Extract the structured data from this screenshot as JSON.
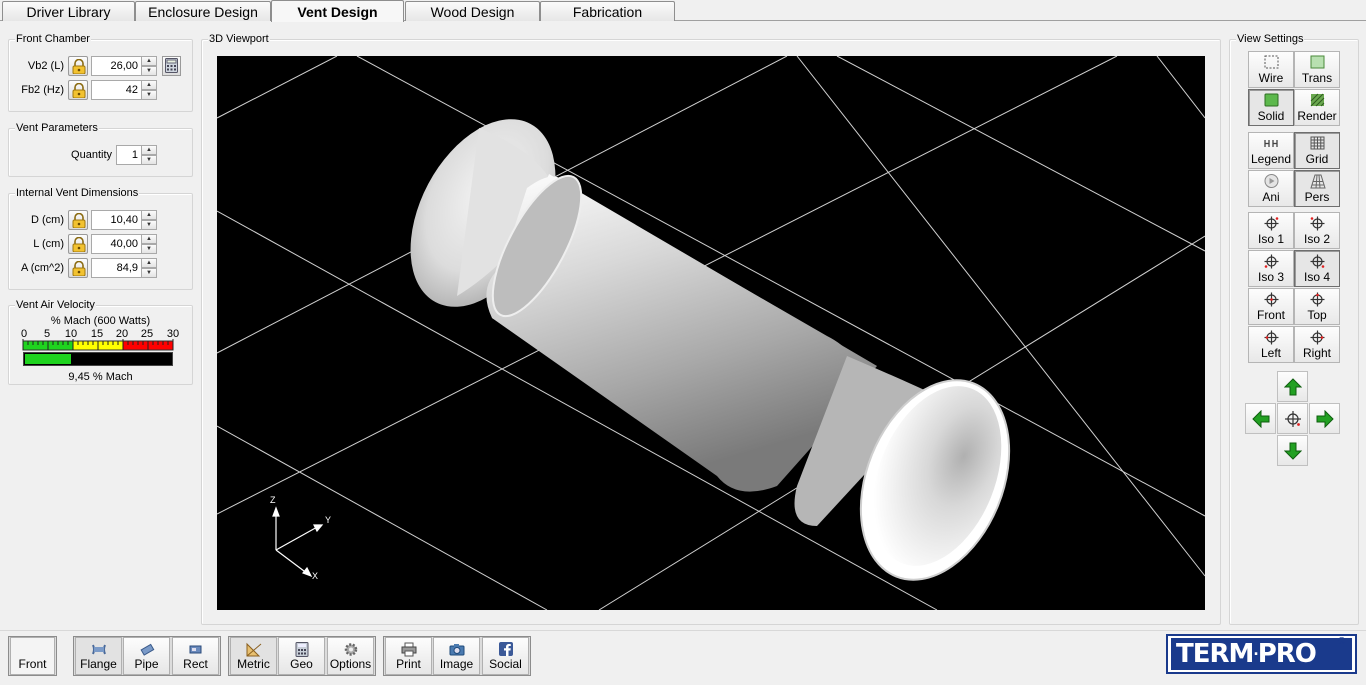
{
  "tabs": [
    {
      "label": "Driver Library",
      "active": false
    },
    {
      "label": "Enclosure Design",
      "active": false
    },
    {
      "label": "Vent Design",
      "active": true
    },
    {
      "label": "Wood Design",
      "active": false
    },
    {
      "label": "Fabrication",
      "active": false
    }
  ],
  "front_chamber": {
    "title": "Front Chamber",
    "vb2_label": "Vb2 (L)",
    "vb2_value": "26,00",
    "fb2_label": "Fb2 (Hz)",
    "fb2_value": "42"
  },
  "vent_parameters": {
    "title": "Vent Parameters",
    "quantity_label": "Quantity",
    "quantity_value": "1"
  },
  "internal_dims": {
    "title": "Internal Vent Dimensions",
    "d_label": "D (cm)",
    "d_value": "10,40",
    "l_label": "L (cm)",
    "l_value": "40,00",
    "a_label": "A (cm^2)",
    "a_value": "84,9"
  },
  "air_velocity": {
    "title": "Vent Air Velocity",
    "scale_title": "% Mach (600 Watts)",
    "scale_ticks": [
      "0",
      "5",
      "10",
      "15",
      "20",
      "25",
      "30"
    ],
    "readout": "9,45 % Mach",
    "mach_percent": 9.45,
    "scale_max": 30,
    "zone_colors": {
      "green": "#1fd31f",
      "yellow": "#ffff00",
      "red": "#ff0000"
    }
  },
  "viewport": {
    "title": "3D Viewport",
    "background": "#000000",
    "axes": {
      "z": "Z",
      "y": "Y",
      "x": "X"
    }
  },
  "view_settings": {
    "title": "View Settings",
    "buttons": [
      {
        "label": "Wire",
        "icon": "wire-icon",
        "on": false
      },
      {
        "label": "Trans",
        "icon": "trans-icon",
        "on": false
      },
      {
        "label": "Solid",
        "icon": "solid-icon",
        "on": true
      },
      {
        "label": "Render",
        "icon": "render-icon",
        "on": false
      },
      {
        "label": "Legend",
        "icon": "legend-icon",
        "on": false
      },
      {
        "label": "Grid",
        "icon": "grid-icon",
        "on": true
      },
      {
        "label": "Ani",
        "icon": "animate-icon",
        "on": false
      },
      {
        "label": "Pers",
        "icon": "perspective-icon",
        "on": true
      },
      {
        "label": "Iso 1",
        "icon": "crosshair-icon",
        "on": false
      },
      {
        "label": "Iso 2",
        "icon": "crosshair-icon",
        "on": false
      },
      {
        "label": "Iso 3",
        "icon": "crosshair-icon",
        "on": false
      },
      {
        "label": "Iso 4",
        "icon": "crosshair-icon",
        "on": true
      },
      {
        "label": "Front",
        "icon": "crosshair-icon",
        "on": false
      },
      {
        "label": "Top",
        "icon": "crosshair-icon",
        "on": false
      },
      {
        "label": "Left",
        "icon": "crosshair-icon",
        "on": false
      },
      {
        "label": "Right",
        "icon": "crosshair-icon",
        "on": false
      }
    ],
    "arrow_color": "#1aa01a"
  },
  "bottom_toolbar": {
    "front_label": "Front",
    "buttons": [
      {
        "label": "Flange",
        "icon": "flange-icon"
      },
      {
        "label": "Pipe",
        "icon": "pipe-icon"
      },
      {
        "label": "Rect",
        "icon": "rect-vent-icon"
      },
      {
        "label": "Metric",
        "icon": "metric-ruler-icon"
      },
      {
        "label": "Geo",
        "icon": "calculator-icon"
      },
      {
        "label": "Options",
        "icon": "gear-icon"
      },
      {
        "label": "Print",
        "icon": "printer-icon"
      },
      {
        "label": "Image",
        "icon": "camera-icon"
      },
      {
        "label": "Social",
        "icon": "facebook-icon"
      }
    ]
  },
  "logo": {
    "text_left": "TERM",
    "text_right": "PRO",
    "mark": "®",
    "color": "#1a3a8c"
  }
}
